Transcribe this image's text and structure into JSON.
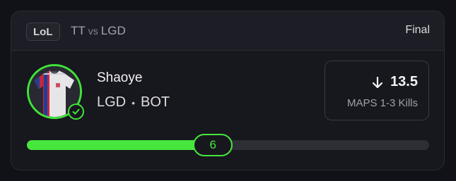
{
  "header": {
    "game": "LoL",
    "team_a": "TT",
    "vs": "vs",
    "team_b": "LGD",
    "status": "Final"
  },
  "player": {
    "name": "Shaoye",
    "team": "LGD",
    "separator": "•",
    "position": "BOT",
    "avatar_icon": "jersey-icon",
    "verified_icon": "check-circle-icon",
    "accent_color": "#46e63d"
  },
  "line": {
    "direction_icon": "arrow-down-icon",
    "value": "13.5",
    "label": "MAPS 1-3 Kills"
  },
  "progress": {
    "current": "6",
    "fraction": 0.445
  }
}
